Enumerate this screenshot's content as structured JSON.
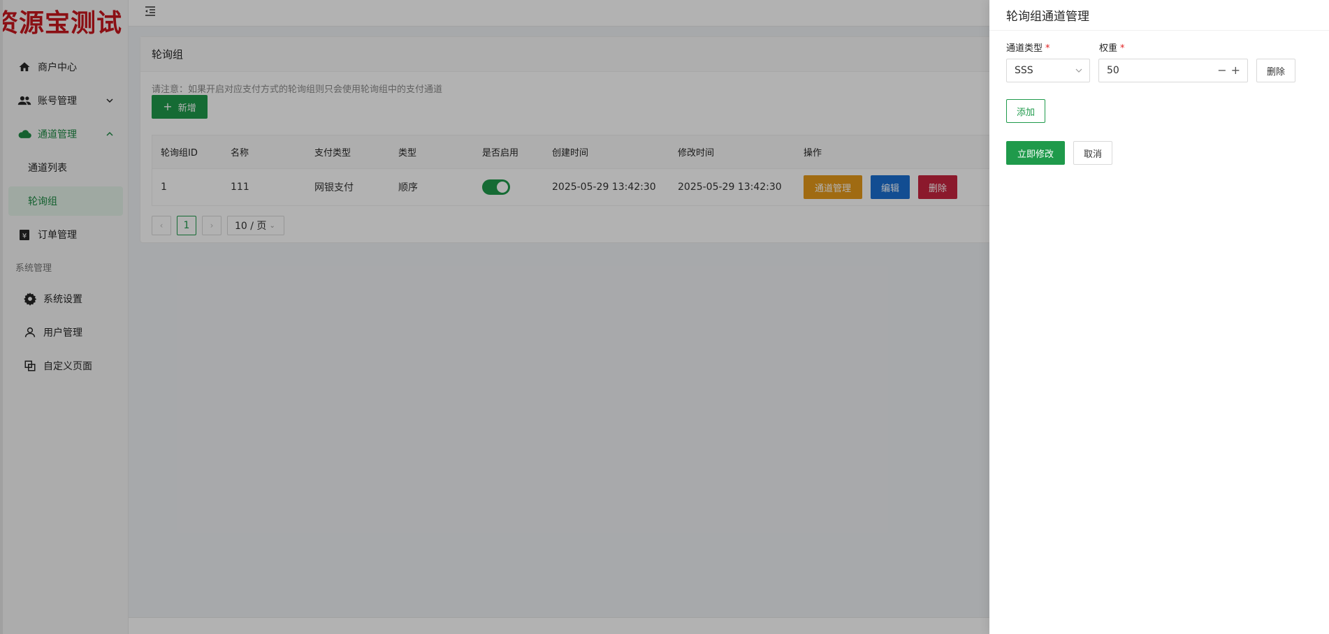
{
  "app": {
    "logo_text": "资源宝测试"
  },
  "sidebar": {
    "items": [
      {
        "label": "商户中心",
        "icon": "home-icon"
      },
      {
        "label": "账号管理",
        "icon": "users-icon"
      },
      {
        "label": "通道管理",
        "icon": "cloud-icon"
      },
      {
        "label": "通道列表"
      },
      {
        "label": "轮询组"
      },
      {
        "label": "订单管理",
        "icon": "order-icon"
      }
    ],
    "group_title": "系统管理",
    "system_items": [
      {
        "label": "系统设置",
        "icon": "gear-icon"
      },
      {
        "label": "用户管理",
        "icon": "user-icon"
      },
      {
        "label": "自定义页面",
        "icon": "pages-icon"
      }
    ]
  },
  "main": {
    "card_title": "轮询组",
    "notice": "请注意：如果开启对应支付方式的轮询组则只会使用轮询组中的支付通道",
    "add_button": "新增",
    "table": {
      "headers": [
        "轮询组ID",
        "名称",
        "支付类型",
        "类型",
        "是否启用",
        "创建时间",
        "修改时间",
        "操作"
      ],
      "rows": [
        {
          "id": "1",
          "name": "111",
          "pay_type": "网银支付",
          "type": "顺序",
          "enabled": true,
          "created": "2025-05-29 13:42:30",
          "modified": "2025-05-29 13:42:30"
        }
      ],
      "actions": {
        "channel": "通道管理",
        "edit": "编辑",
        "delete": "删除"
      }
    },
    "pagination": {
      "current": "1",
      "page_size": "10 / 页"
    }
  },
  "drawer": {
    "title": "轮询组通道管理",
    "channel_type_label": "通道类型",
    "weight_label": "权重",
    "required_mark": "*",
    "channel_type_value": "SSS",
    "weight_value": "50",
    "delete_label": "删除",
    "add_label": "添加",
    "submit_label": "立即修改",
    "cancel_label": "取消"
  },
  "colors": {
    "accent": "#1f9a4b",
    "warning": "#e59a1a",
    "info": "#1a6fd1",
    "danger": "#c8253f",
    "logo": "#c8161d"
  }
}
